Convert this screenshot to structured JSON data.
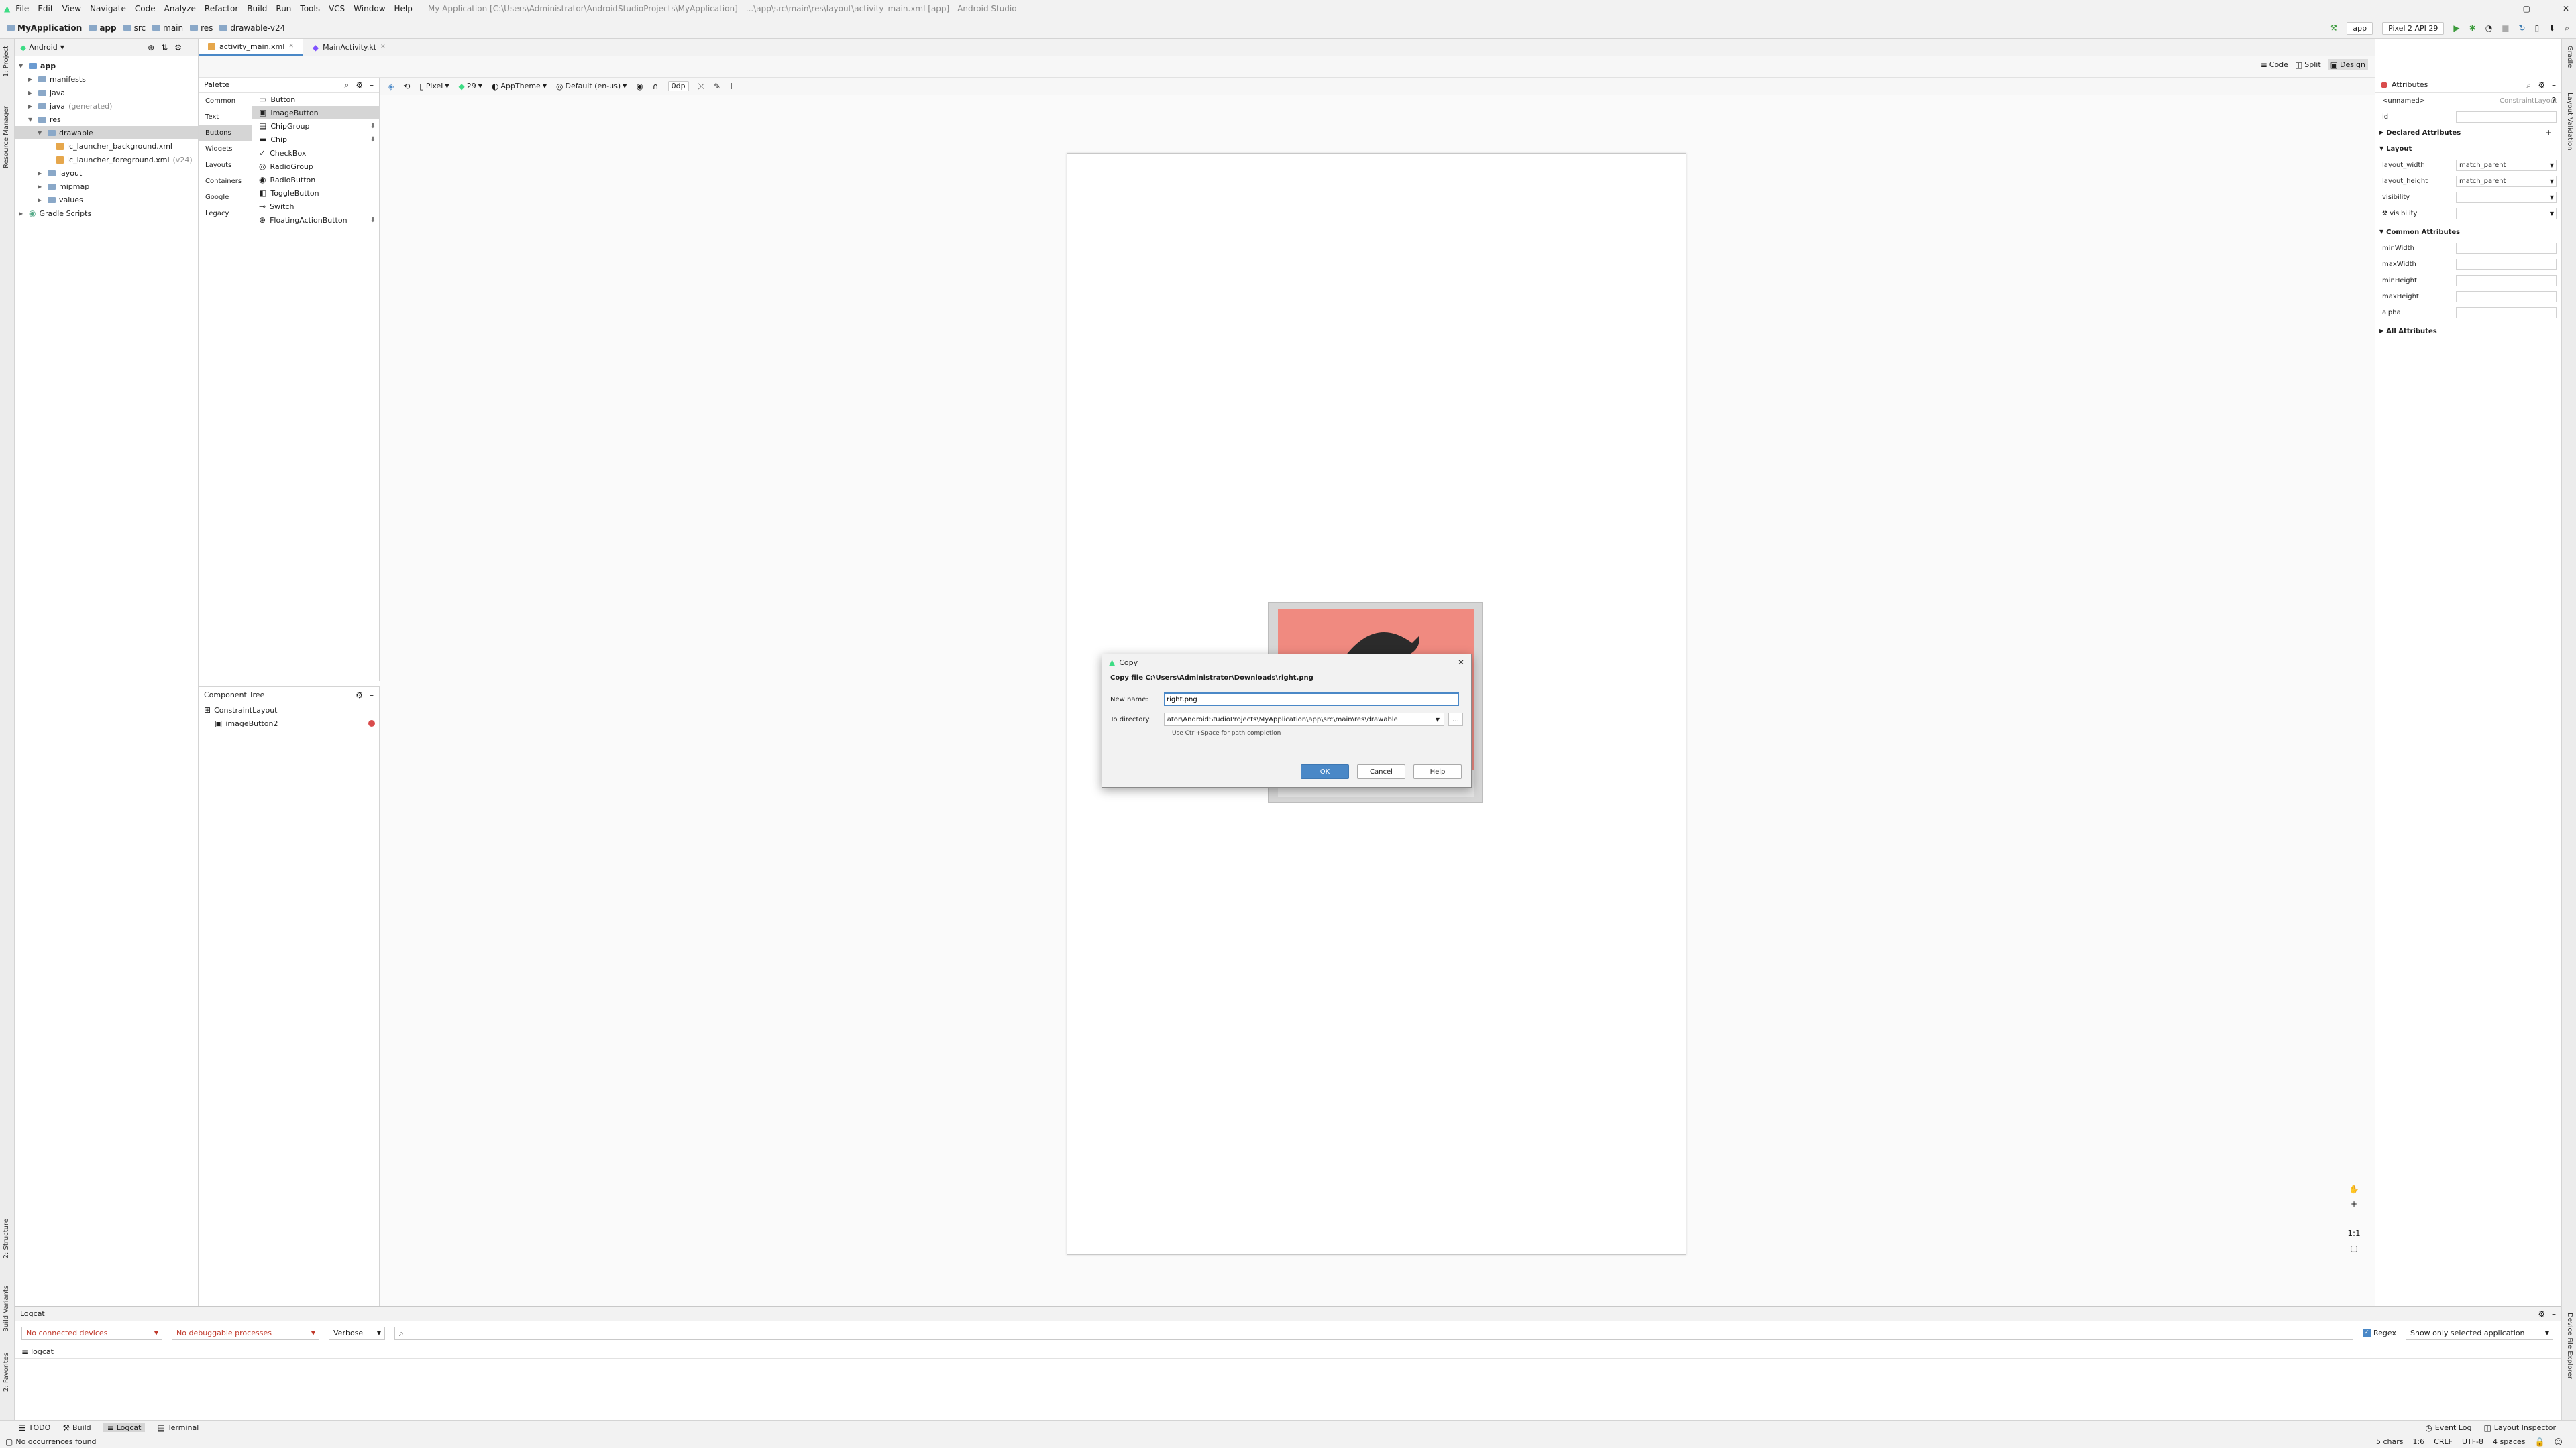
{
  "menu": {
    "items": [
      "File",
      "Edit",
      "View",
      "Navigate",
      "Code",
      "Analyze",
      "Refactor",
      "Build",
      "Run",
      "Tools",
      "VCS",
      "Window",
      "Help"
    ],
    "window_title": "My Application [C:\\Users\\Administrator\\AndroidStudioProjects\\MyApplication] - ...\\app\\src\\main\\res\\layout\\activity_main.xml [app] - Android Studio"
  },
  "breadcrumb": [
    "MyApplication",
    "app",
    "src",
    "main",
    "res",
    "drawable-v24"
  ],
  "run": {
    "config": "app",
    "device": "Pixel 2 API 29"
  },
  "project": {
    "view": "Android",
    "tree": [
      {
        "label": "app",
        "level": 0
      },
      {
        "label": "manifests",
        "level": 1
      },
      {
        "label": "java",
        "level": 1
      },
      {
        "label": "java",
        "suffix": "(generated)",
        "level": 1
      },
      {
        "label": "res",
        "level": 1
      },
      {
        "label": "drawable",
        "level": 2,
        "selected": true
      },
      {
        "label": "ic_launcher_background.xml",
        "level": 3
      },
      {
        "label": "ic_launcher_foreground.xml",
        "suffix": "(v24)",
        "level": 3
      },
      {
        "label": "layout",
        "level": 2
      },
      {
        "label": "mipmap",
        "level": 2
      },
      {
        "label": "values",
        "level": 2
      },
      {
        "label": "Gradle Scripts",
        "level": 0
      }
    ]
  },
  "editor_tabs": [
    "activity_main.xml",
    "MainActivity.kt"
  ],
  "modes": [
    "Code",
    "Split",
    "Design"
  ],
  "design_bar": {
    "device": "Pixel",
    "api": "29",
    "theme": "AppTheme",
    "locale": "Default (en-us)",
    "dp": "0dp"
  },
  "palette": {
    "title": "Palette",
    "categories": [
      "Common",
      "Text",
      "Buttons",
      "Widgets",
      "Layouts",
      "Containers",
      "Google",
      "Legacy"
    ],
    "items": [
      "Button",
      "ImageButton",
      "ChipGroup",
      "Chip",
      "CheckBox",
      "RadioGroup",
      "RadioButton",
      "ToggleButton",
      "Switch",
      "FloatingActionButton"
    ]
  },
  "component_tree": {
    "title": "Component Tree",
    "root": "ConstraintLayout",
    "child": "imageButton2"
  },
  "attributes": {
    "title": "Attributes",
    "unnamed": "<unnamed>",
    "class_hint": "ConstraintLayout",
    "id_label": "id",
    "declared": "Declared Attributes",
    "layout": "Layout",
    "layout_rows": [
      {
        "name": "layout_width",
        "value": "match_parent"
      },
      {
        "name": "layout_height",
        "value": "match_parent"
      },
      {
        "name": "visibility",
        "value": ""
      },
      {
        "name": "visibility",
        "value": ""
      }
    ],
    "common": "Common Attributes",
    "common_rows": [
      "minWidth",
      "maxWidth",
      "minHeight",
      "maxHeight",
      "alpha"
    ],
    "all": "All Attributes"
  },
  "dialog": {
    "title": "Copy",
    "heading": "Copy file C:\\Users\\Administrator\\Downloads\\right.png",
    "new_name_label": "New name:",
    "new_name_value": "right.png",
    "to_dir_label": "To directory:",
    "to_dir_value": "ator\\AndroidStudioProjects\\MyApplication\\app\\src\\main\\res\\drawable",
    "hint": "Use Ctrl+Space for path completion",
    "ok": "OK",
    "cancel": "Cancel",
    "help": "Help"
  },
  "logcat": {
    "title": "Logcat",
    "devices": "No connected devices",
    "processes": "No debuggable processes",
    "level": "Verbose",
    "regex": "Regex",
    "filter": "Show only selected application",
    "tab": "logcat"
  },
  "bottom_tools": [
    "TODO",
    "Build",
    "Logcat",
    "Terminal"
  ],
  "bottom_right": [
    "Event Log",
    "Layout Inspector"
  ],
  "status": {
    "left": "No occurrences found",
    "right": [
      "5 chars",
      "1:6",
      "CRLF",
      "UTF-8",
      "4 spaces"
    ]
  },
  "stripes": {
    "left": [
      "1: Project",
      "Resource Manager",
      "2: Structure",
      "Build Variants",
      "2: Favorites"
    ],
    "right": [
      "Gradle",
      "Layout Validation",
      "Device File Explorer"
    ]
  },
  "colors": {
    "accent": "#4a88c7",
    "error": "#d94c4c",
    "image": "#f08a80"
  }
}
